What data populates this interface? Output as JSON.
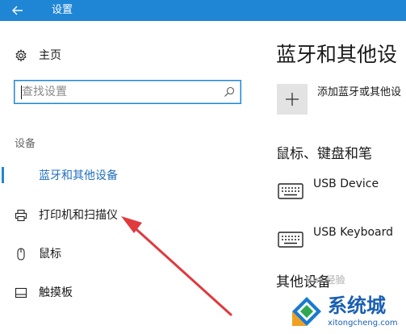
{
  "titlebar": {
    "title": "设置",
    "back_icon": "back-arrow-icon"
  },
  "sidebar": {
    "home_label": "主页",
    "search_placeholder": "查找设置",
    "section_label": "设备",
    "items": [
      {
        "label": "蓝牙和其他设备",
        "icon": "bluetooth-devices-icon",
        "selected": true
      },
      {
        "label": "打印机和扫描仪",
        "icon": "printer-icon",
        "selected": false
      },
      {
        "label": "鼠标",
        "icon": "mouse-icon",
        "selected": false
      },
      {
        "label": "触摸板",
        "icon": "touchpad-icon",
        "selected": false
      }
    ]
  },
  "main": {
    "page_title": "蓝牙和其他设",
    "add_label": "添加蓝牙或其他设",
    "section_heading": "鼠标、键盘和笔",
    "devices": [
      {
        "name": "USB Device",
        "icon": "keyboard-icon"
      },
      {
        "name": "USB Keyboard",
        "icon": "keyboard-icon"
      }
    ],
    "section_heading_2": "其他设备"
  },
  "watermark": {
    "baidu": "Bai 经验",
    "brand": "系统城",
    "url": "xitongcheng.com"
  },
  "colors": {
    "accent": "#1f86d6",
    "annotation_arrow": "#e0393e"
  }
}
